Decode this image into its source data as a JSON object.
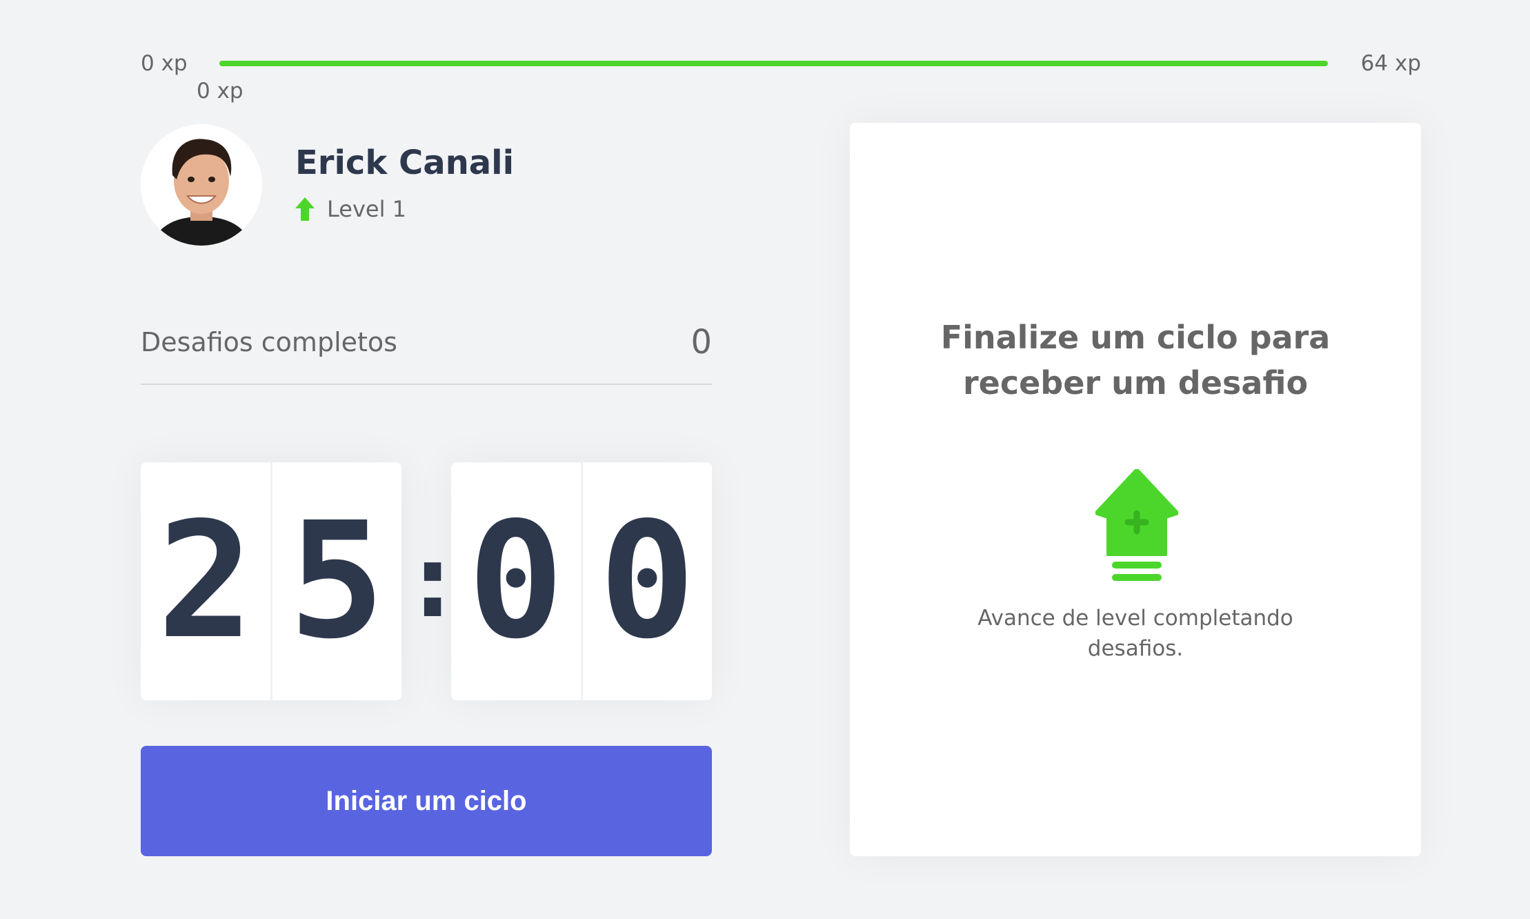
{
  "xp_bar": {
    "start_label": "0 xp",
    "end_label": "64 xp",
    "current_label": "0 xp",
    "progress_fraction": 1.0,
    "fill_color": "#4cd62b"
  },
  "profile": {
    "name": "Erick Canali",
    "level_label": "Level 1",
    "level_icon": "level-up-arrow-icon",
    "avatar": "user-avatar-photo"
  },
  "completed_challenges": {
    "label": "Desafios completos",
    "count": "0"
  },
  "countdown": {
    "minute_tens": "2",
    "minute_units": "5",
    "separator": ":",
    "second_tens": "0",
    "second_units": "0"
  },
  "start_button": {
    "label": "Iniciar um ciclo",
    "color": "#5965e0"
  },
  "challenge_box": {
    "title": "Finalize um ciclo para receber um desafio",
    "icon": "level-up-icon",
    "hint": "Avance de level completando desafios."
  },
  "colors": {
    "background": "#f2f3f5",
    "title_text": "#2e384d",
    "body_text": "#666666",
    "green": "#4cd62b",
    "blue": "#5965e0"
  }
}
